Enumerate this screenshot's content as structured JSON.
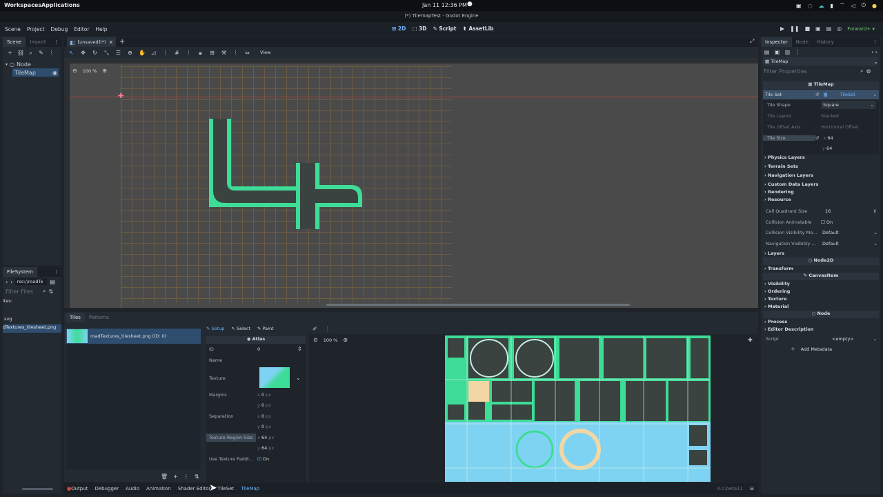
{
  "os": {
    "workspaces": "Workspaces",
    "applications": "Applications",
    "clock": "Jan 11  12:36 PM"
  },
  "window": {
    "title": "(*) TilemapTest - Godot Engine"
  },
  "menu": [
    "Scene",
    "Project",
    "Debug",
    "Editor",
    "Help"
  ],
  "workspaces": [
    "2D",
    "3D",
    "Script",
    "AssetLib"
  ],
  "renderer": "Forward+",
  "scene_dock": {
    "tabs": [
      "Scene",
      "Import"
    ],
    "tree": [
      {
        "label": "Node"
      },
      {
        "label": "TileMap"
      }
    ]
  },
  "filesystem": {
    "title": "FileSystem",
    "path": "res://roadTe",
    "filter_placeholder": "Filter Files",
    "items": [
      "ites:",
      ".svg",
      "dTextures_tilesheet.png"
    ]
  },
  "editor_tab": {
    "label": "[unsaved](*)"
  },
  "viewport": {
    "view_label": "View",
    "zoom": "100 %"
  },
  "bottom_panel": {
    "tabs": [
      "Tiles",
      "Patterns"
    ],
    "source_item": "roadTextures_tilesheet.png (ID: 0)",
    "setup_tabs": [
      "Setup",
      "Select",
      "Paint"
    ],
    "atlas_title": "Atlas",
    "fields": {
      "id_label": "ID",
      "id_value": "0",
      "name_label": "Name",
      "texture_label": "Texture",
      "margins_label": "Margins",
      "margins_x": "0",
      "margins_y": "0",
      "separation_label": "Separation",
      "separation_x": "0",
      "separation_y": "0",
      "region_label": "Texture Region Size",
      "region_x": "64",
      "region_y": "64",
      "padding_label": "Use Texture Paddi...",
      "padding_value": "On",
      "unit": "px"
    },
    "atlas_zoom": "100 %"
  },
  "bottom_tabs": [
    "Output",
    "Debugger",
    "Audio",
    "Animation",
    "Shader Editor",
    "TileSet",
    "TileMap"
  ],
  "version": "4.0.beta11",
  "inspector": {
    "tabs": [
      "Inspector",
      "Node",
      "History"
    ],
    "object": "TileMap",
    "filter_placeholder": "Filter Properties",
    "class_header": "TileMap",
    "tileset_label": "Tile Set",
    "tileset_value": "TileSet",
    "tile_shape_label": "Tile Shape",
    "tile_shape_value": "Square",
    "tile_layout_label": "Tile Layout",
    "tile_layout_value": "Stacked",
    "offset_axis_label": "Tile Offset Axis",
    "offset_axis_value": "Horizontal Offset",
    "tile_size_label": "Tile Size",
    "tile_size_x": "64",
    "tile_size_y": "64",
    "groups": [
      "Physics Layers",
      "Terrain Sets",
      "Navigation Layers",
      "Custom Data Layers",
      "Rendering",
      "Resource"
    ],
    "cell_quadrant_label": "Cell Quadrant Size",
    "cell_quadrant_value": "16",
    "collision_anim_label": "Collision Animatable",
    "collision_anim_value": "On",
    "collision_vis_label": "Collision Visibility Mo...",
    "collision_vis_value": "Default",
    "nav_vis_label": "Navigation Visibility ...",
    "nav_vis_value": "Default",
    "layers": "Layers",
    "node2d": "Node2D",
    "transform": "Transform",
    "canvasitem": "CanvasItem",
    "canvas_groups": [
      "Visibility",
      "Ordering",
      "Texture",
      "Material"
    ],
    "node": "Node",
    "node_groups": [
      "Process",
      "Editor Description"
    ],
    "script_label": "Script",
    "script_value": "<empty>",
    "add_metadata": "Add Metadata"
  },
  "colors": {
    "accent": "#4ea4ff",
    "tile_green": "#3ddc97",
    "tile_dark": "#3a4340",
    "tile_blue": "#7fd3f2"
  }
}
